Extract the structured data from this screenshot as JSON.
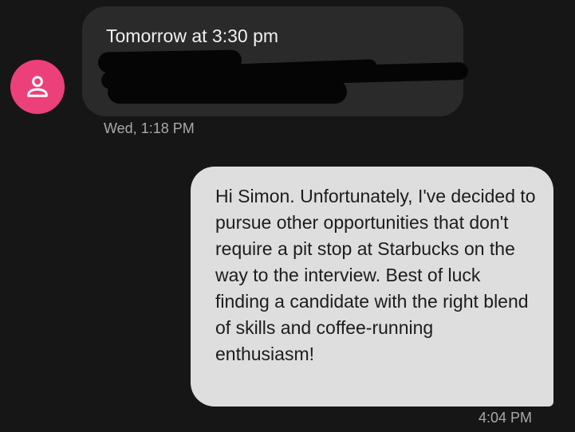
{
  "conversation": {
    "incoming": {
      "text": "Tomorrow at 3:30 pm",
      "timestamp": "Wed, 1:18 PM",
      "avatar_icon": "person-icon",
      "avatar_color": "#ec407a"
    },
    "outgoing": {
      "text": "Hi Simon. Unfortunately, I've decided to pursue other opportunities that don't require a pit stop at Starbucks on the way to the interview. Best of luck finding a candidate with the right blend of skills and coffee-running enthusiasm!",
      "timestamp": "4:04 PM"
    }
  },
  "colors": {
    "background": "#161616",
    "incoming_bubble": "#2a2a2a",
    "outgoing_bubble": "#dedede",
    "timestamp": "#a9a9a9"
  }
}
